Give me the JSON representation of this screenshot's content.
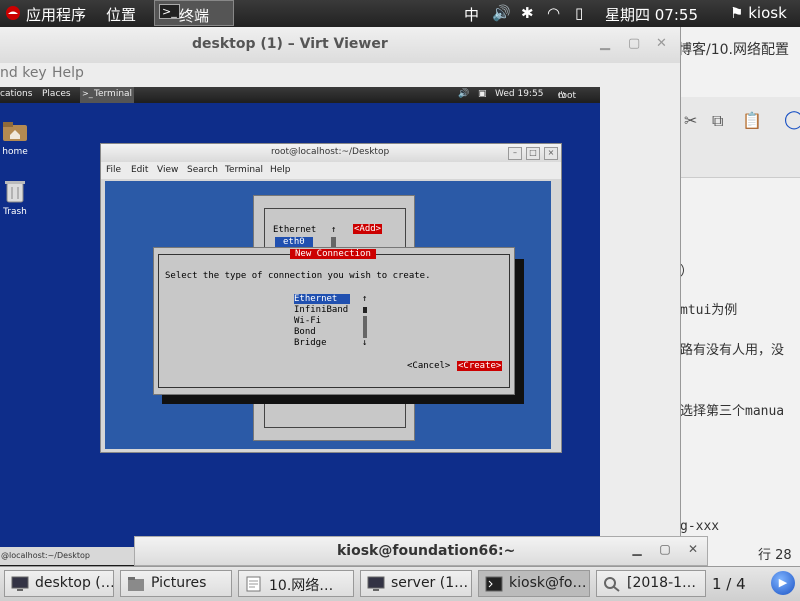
{
  "host_topbar": {
    "applications": "应用程序",
    "places": "位置",
    "terminal": "终端",
    "input_method": "中",
    "datetime": "星期四 07:55",
    "user": "kiosk"
  },
  "editor_bg": {
    "title_fragment": "博客/10.网络配置",
    "lines": [
      "）",
      "mtui为例",
      "路有没有人用，没",
      "选择第三个manua",
      "g-xxx"
    ],
    "status": "行 28"
  },
  "virt_viewer": {
    "title": "desktop (1) – Virt Viewer",
    "menu": [
      "nd key",
      "Help"
    ]
  },
  "guest": {
    "topbar": {
      "applications": "cations",
      "places": "Places",
      "terminal": "Terminal",
      "time": "Wed 19:55",
      "user": "root"
    },
    "icons": [
      {
        "label": "home"
      },
      {
        "label": "Trash"
      }
    ],
    "status_fragment": "@localhost:~/Desktop",
    "terminal": {
      "title": "root@localhost:~/Desktop",
      "menu": [
        "File",
        "Edit",
        "View",
        "Search",
        "Terminal",
        "Help"
      ],
      "tui_back": {
        "list_item": "Ethernet",
        "iface": "eth0",
        "add": "<Add>"
      },
      "dialog": {
        "title": "New Connection",
        "prompt": "Select the type of connection you wish to create.",
        "options": [
          "Ethernet",
          "InfiniBand",
          "Wi-Fi",
          "Bond",
          "Bridge"
        ],
        "selected": "Ethernet",
        "cancel": "<Cancel>",
        "create": "<Create>"
      }
    }
  },
  "kiosk_terminal": {
    "title": "kiosk@foundation66:~"
  },
  "taskbar": {
    "tasks": [
      "desktop (…",
      "Pictures",
      "10.网络…",
      "server (1…",
      "kiosk@fo…",
      "[2018-1…"
    ],
    "pager": "1 / 4"
  }
}
